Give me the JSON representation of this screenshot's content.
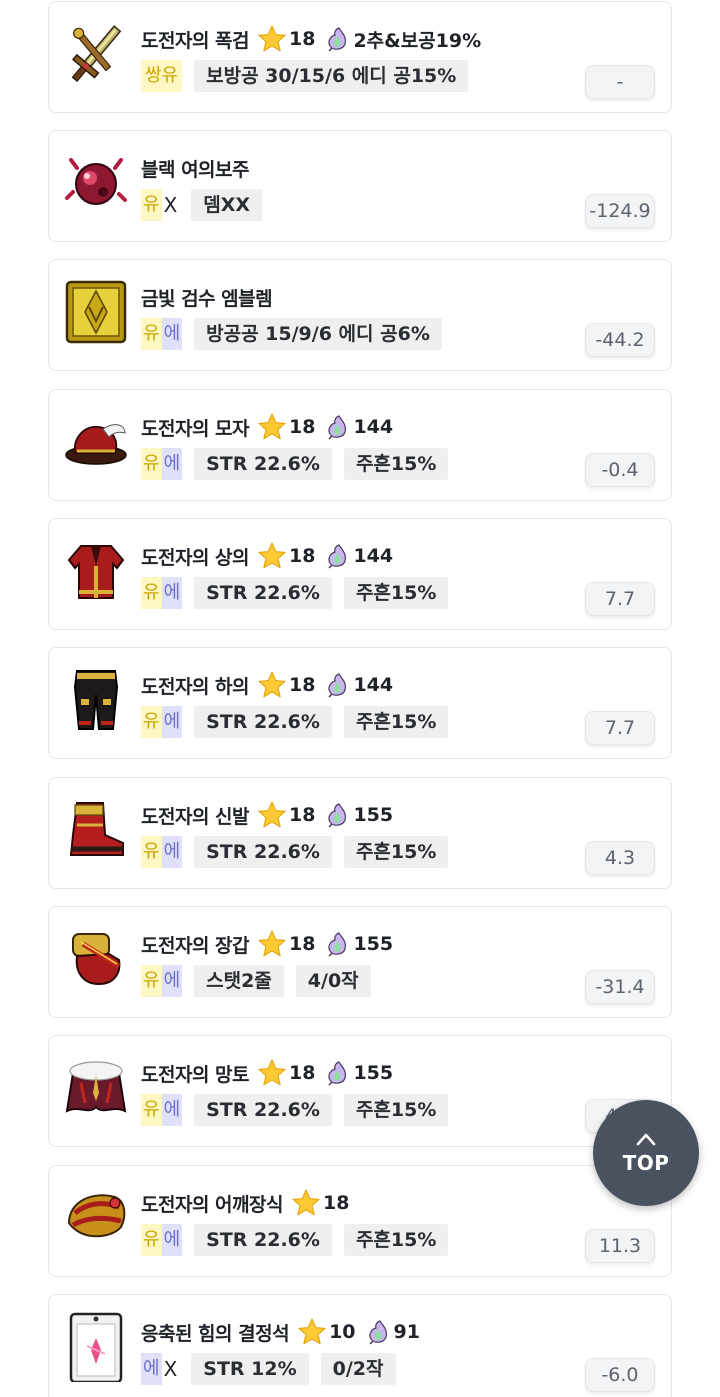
{
  "colors": {
    "legendary_bg": "#fff7c2",
    "legendary_text": "#c9a400",
    "epic_bg": "#e0e1f8",
    "epic_text": "#6a6fcf",
    "chip_bg": "#efefef",
    "top_button_bg": "#4a5260"
  },
  "items": [
    {
      "name": "도전자의 폭검",
      "icon": "challenger-sword-icon",
      "star": "18",
      "flame": "2추&보공19%",
      "potential": [
        {
          "text": "쌍유",
          "tier": "legendary"
        }
      ],
      "options": [
        "보방공 30/15/6 에디 공15%"
      ],
      "value": "-"
    },
    {
      "name": "블랙 여의보주",
      "icon": "black-orb-icon",
      "star": "",
      "flame": "",
      "potential": [
        {
          "text": "유",
          "tier": "legendary"
        },
        {
          "text": "X",
          "tier": "none"
        }
      ],
      "options": [
        "뎀XX"
      ],
      "value": "-124.9"
    },
    {
      "name": "금빛 검수 엠블렘",
      "icon": "golden-emblem-icon",
      "star": "",
      "flame": "",
      "potential": [
        {
          "text": "유",
          "tier": "legendary"
        },
        {
          "text": "에",
          "tier": "epic"
        }
      ],
      "options": [
        "방공공 15/9/6 에디 공6%"
      ],
      "value": "-44.2"
    },
    {
      "name": "도전자의 모자",
      "icon": "challenger-hat-icon",
      "star": "18",
      "flame": "144",
      "potential": [
        {
          "text": "유",
          "tier": "legendary"
        },
        {
          "text": "에",
          "tier": "epic"
        }
      ],
      "options": [
        "STR 22.6%",
        "주흔15%"
      ],
      "value": "-0.4"
    },
    {
      "name": "도전자의 상의",
      "icon": "challenger-top-icon",
      "star": "18",
      "flame": "144",
      "potential": [
        {
          "text": "유",
          "tier": "legendary"
        },
        {
          "text": "에",
          "tier": "epic"
        }
      ],
      "options": [
        "STR 22.6%",
        "주흔15%"
      ],
      "value": "7.7"
    },
    {
      "name": "도전자의 하의",
      "icon": "challenger-bottom-icon",
      "star": "18",
      "flame": "144",
      "potential": [
        {
          "text": "유",
          "tier": "legendary"
        },
        {
          "text": "에",
          "tier": "epic"
        }
      ],
      "options": [
        "STR 22.6%",
        "주흔15%"
      ],
      "value": "7.7"
    },
    {
      "name": "도전자의 신발",
      "icon": "challenger-shoes-icon",
      "star": "18",
      "flame": "155",
      "potential": [
        {
          "text": "유",
          "tier": "legendary"
        },
        {
          "text": "에",
          "tier": "epic"
        }
      ],
      "options": [
        "STR 22.6%",
        "주흔15%"
      ],
      "value": "4.3"
    },
    {
      "name": "도전자의 장갑",
      "icon": "challenger-gloves-icon",
      "star": "18",
      "flame": "155",
      "potential": [
        {
          "text": "유",
          "tier": "legendary"
        },
        {
          "text": "에",
          "tier": "epic"
        }
      ],
      "options": [
        "스탯2줄",
        "4/0작"
      ],
      "value": "-31.4"
    },
    {
      "name": "도전자의 망토",
      "icon": "challenger-cape-icon",
      "star": "18",
      "flame": "155",
      "potential": [
        {
          "text": "유",
          "tier": "legendary"
        },
        {
          "text": "에",
          "tier": "epic"
        }
      ],
      "options": [
        "STR 22.6%",
        "주흔15%"
      ],
      "value": "4.3"
    },
    {
      "name": "도전자의 어깨장식",
      "icon": "challenger-shoulder-icon",
      "star": "18",
      "flame": "",
      "potential": [
        {
          "text": "유",
          "tier": "legendary"
        },
        {
          "text": "에",
          "tier": "epic"
        }
      ],
      "options": [
        "STR 22.6%",
        "주흔15%"
      ],
      "value": "11.3"
    },
    {
      "name": "응축된 힘의 결정석",
      "icon": "crystal-stone-icon",
      "star": "10",
      "flame": "91",
      "potential": [
        {
          "text": "에",
          "tier": "epic"
        },
        {
          "text": "X",
          "tier": "none"
        }
      ],
      "options": [
        "STR 12%",
        "0/2작"
      ],
      "value": "-6.0"
    }
  ],
  "top_button": {
    "label": "TOP",
    "icon": "chevron-up-icon"
  }
}
